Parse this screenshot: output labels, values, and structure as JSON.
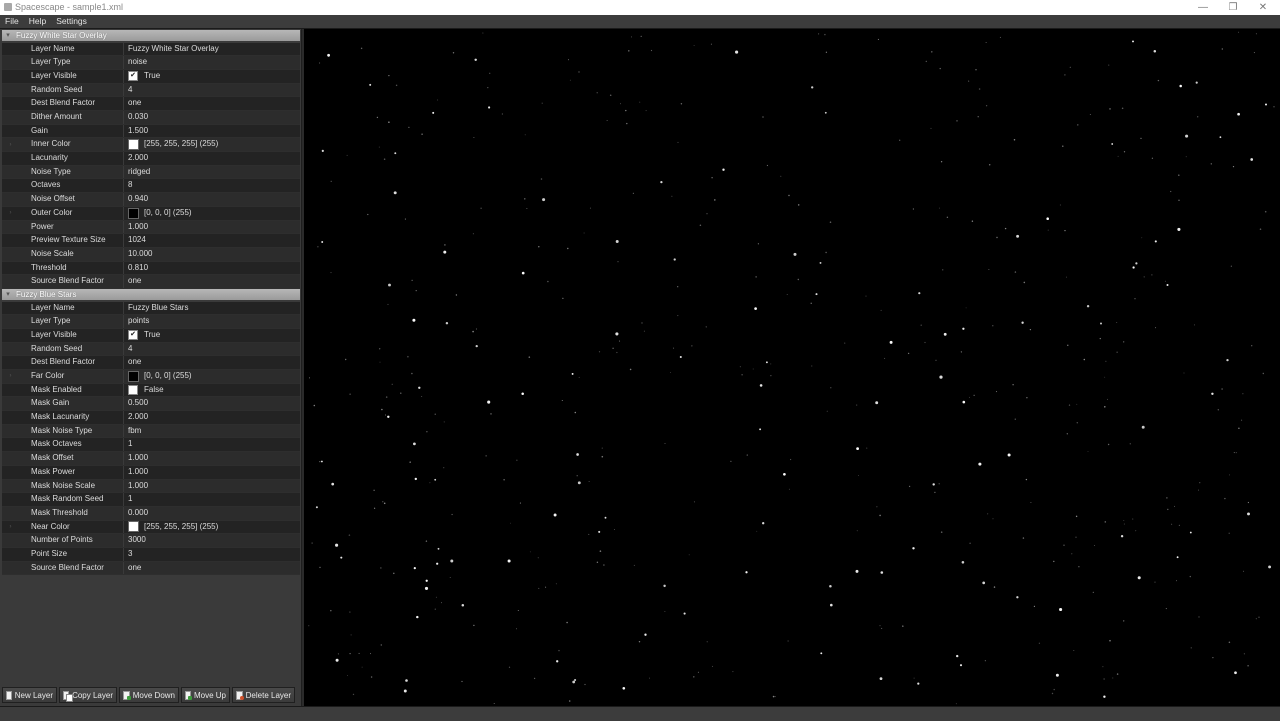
{
  "window": {
    "title": "Spacescape - sample1.xml",
    "minimize_label": "—",
    "restore_label": "❐",
    "close_label": "✕"
  },
  "menu": {
    "items": [
      "File",
      "Help",
      "Settings"
    ]
  },
  "layers": [
    {
      "title": "Fuzzy White Star Overlay",
      "expanded": true,
      "properties": [
        {
          "name": "Layer Name",
          "value": "Fuzzy White Star Overlay"
        },
        {
          "name": "Layer Type",
          "value": "noise"
        },
        {
          "name": "Layer Visible",
          "value": "True",
          "kind": "checkbox",
          "checked": true
        },
        {
          "name": "Random Seed",
          "value": "4"
        },
        {
          "name": "Dest Blend Factor",
          "value": "one"
        },
        {
          "name": "Dither Amount",
          "value": "0.030"
        },
        {
          "name": "Gain",
          "value": "1.500"
        },
        {
          "name": "Inner Color",
          "value": "[255, 255, 255] (255)",
          "kind": "color",
          "color": "#ffffff",
          "expandable": true
        },
        {
          "name": "Lacunarity",
          "value": "2.000"
        },
        {
          "name": "Noise Type",
          "value": "ridged"
        },
        {
          "name": "Octaves",
          "value": "8"
        },
        {
          "name": "Noise Offset",
          "value": "0.940"
        },
        {
          "name": "Outer Color",
          "value": "[0, 0, 0] (255)",
          "kind": "color",
          "color": "#000000",
          "expandable": true
        },
        {
          "name": "Power",
          "value": "1.000"
        },
        {
          "name": "Preview Texture Size",
          "value": "1024"
        },
        {
          "name": "Noise Scale",
          "value": "10.000"
        },
        {
          "name": "Threshold",
          "value": "0.810"
        },
        {
          "name": "Source Blend Factor",
          "value": "one"
        }
      ]
    },
    {
      "title": "Fuzzy Blue Stars",
      "expanded": true,
      "properties": [
        {
          "name": "Layer Name",
          "value": "Fuzzy Blue Stars"
        },
        {
          "name": "Layer Type",
          "value": "points"
        },
        {
          "name": "Layer Visible",
          "value": "True",
          "kind": "checkbox",
          "checked": true
        },
        {
          "name": "Random Seed",
          "value": "4"
        },
        {
          "name": "Dest Blend Factor",
          "value": "one"
        },
        {
          "name": "Far Color",
          "value": "[0, 0, 0] (255)",
          "kind": "color",
          "color": "#000000",
          "expandable": true
        },
        {
          "name": "Mask Enabled",
          "value": "False",
          "kind": "checkbox",
          "checked": false
        },
        {
          "name": "Mask Gain",
          "value": "0.500"
        },
        {
          "name": "Mask Lacunarity",
          "value": "2.000"
        },
        {
          "name": "Mask Noise Type",
          "value": "fbm"
        },
        {
          "name": "Mask Octaves",
          "value": "1"
        },
        {
          "name": "Mask Offset",
          "value": "1.000"
        },
        {
          "name": "Mask Power",
          "value": "1.000"
        },
        {
          "name": "Mask Noise Scale",
          "value": "1.000"
        },
        {
          "name": "Mask Random Seed",
          "value": "1"
        },
        {
          "name": "Mask Threshold",
          "value": "0.000"
        },
        {
          "name": "Near Color",
          "value": "[255, 255, 255] (255)",
          "kind": "color",
          "color": "#ffffff",
          "expandable": true
        },
        {
          "name": "Number of Points",
          "value": "3000"
        },
        {
          "name": "Point Size",
          "value": "3"
        },
        {
          "name": "Source Blend Factor",
          "value": "one"
        }
      ]
    }
  ],
  "buttons": [
    {
      "label": "New Layer",
      "icon": "new-layer-icon"
    },
    {
      "label": "Copy Layer",
      "icon": "copy-layer-icon"
    },
    {
      "label": "Move Down",
      "icon": "move-down-icon"
    },
    {
      "label": "Move Up",
      "icon": "move-up-icon"
    },
    {
      "label": "Delete Layer",
      "icon": "delete-layer-icon"
    }
  ],
  "colors": {
    "viewport_background": "#000000",
    "panel_background": "#3a3a3a",
    "group_header": "#a8a8a8"
  }
}
